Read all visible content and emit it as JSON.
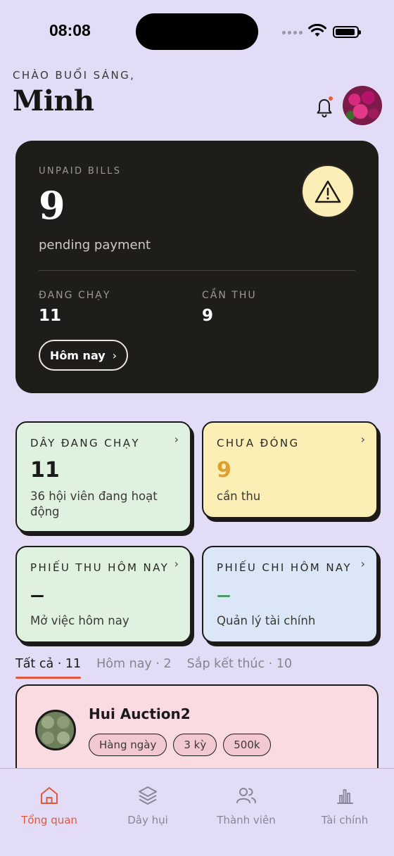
{
  "status_bar": {
    "time": "08:08"
  },
  "header": {
    "greeting": "CHÀO BUỔI SÁNG,",
    "user_name": "Minh",
    "bell_icon": "bell-icon",
    "has_notification": true
  },
  "unpaid_card": {
    "label": "UNPAID BILLS",
    "count": "9",
    "subtitle": "pending payment",
    "icon": "warning-icon",
    "stats": [
      {
        "label": "ĐANG CHẠY",
        "value": "11"
      },
      {
        "label": "CẦN THU",
        "value": "9"
      }
    ],
    "button_label": "Hôm nay"
  },
  "stat_cards": [
    {
      "title": "DÂY ĐANG CHẠY",
      "value": "11",
      "subtitle": "36 hội viên đang hoạt động",
      "color": "#dff1df"
    },
    {
      "title": "CHƯA ĐÓNG",
      "value": "9",
      "subtitle": "cần thu",
      "color": "#fbefb6",
      "value_color": "#e0a030"
    },
    {
      "title": "PHIẾU THU HÔM NAY",
      "value": "—",
      "subtitle": "Mở việc hôm nay",
      "color": "#dff1df"
    },
    {
      "title": "PHIẾU CHI HÔM NAY",
      "value": "—",
      "subtitle": "Quản lý tài chính",
      "color": "#dbe6f6",
      "value_color": "#4f9a6a"
    }
  ],
  "tabs": [
    {
      "label": "Tất cả · 11",
      "active": true
    },
    {
      "label": "Hôm nay · 2",
      "active": false
    },
    {
      "label": "Sắp kết thúc · 10",
      "active": false
    }
  ],
  "list": [
    {
      "title": "Hui Auction2",
      "tags": [
        "Hàng ngày",
        "3 kỳ",
        "500k"
      ]
    }
  ],
  "bottom_nav": [
    {
      "label": "Tổng quan",
      "icon": "home-icon",
      "active": true
    },
    {
      "label": "Dây hụi",
      "icon": "layers-icon",
      "active": false
    },
    {
      "label": "Thành viên",
      "icon": "users-icon",
      "active": false
    },
    {
      "label": "Tài chính",
      "icon": "chart-icon",
      "active": false
    }
  ],
  "colors": {
    "background": "#e3dcf6",
    "accent": "#e2583e",
    "dark_card": "#1f1d1a",
    "warning_bg": "#fbeeb6"
  }
}
